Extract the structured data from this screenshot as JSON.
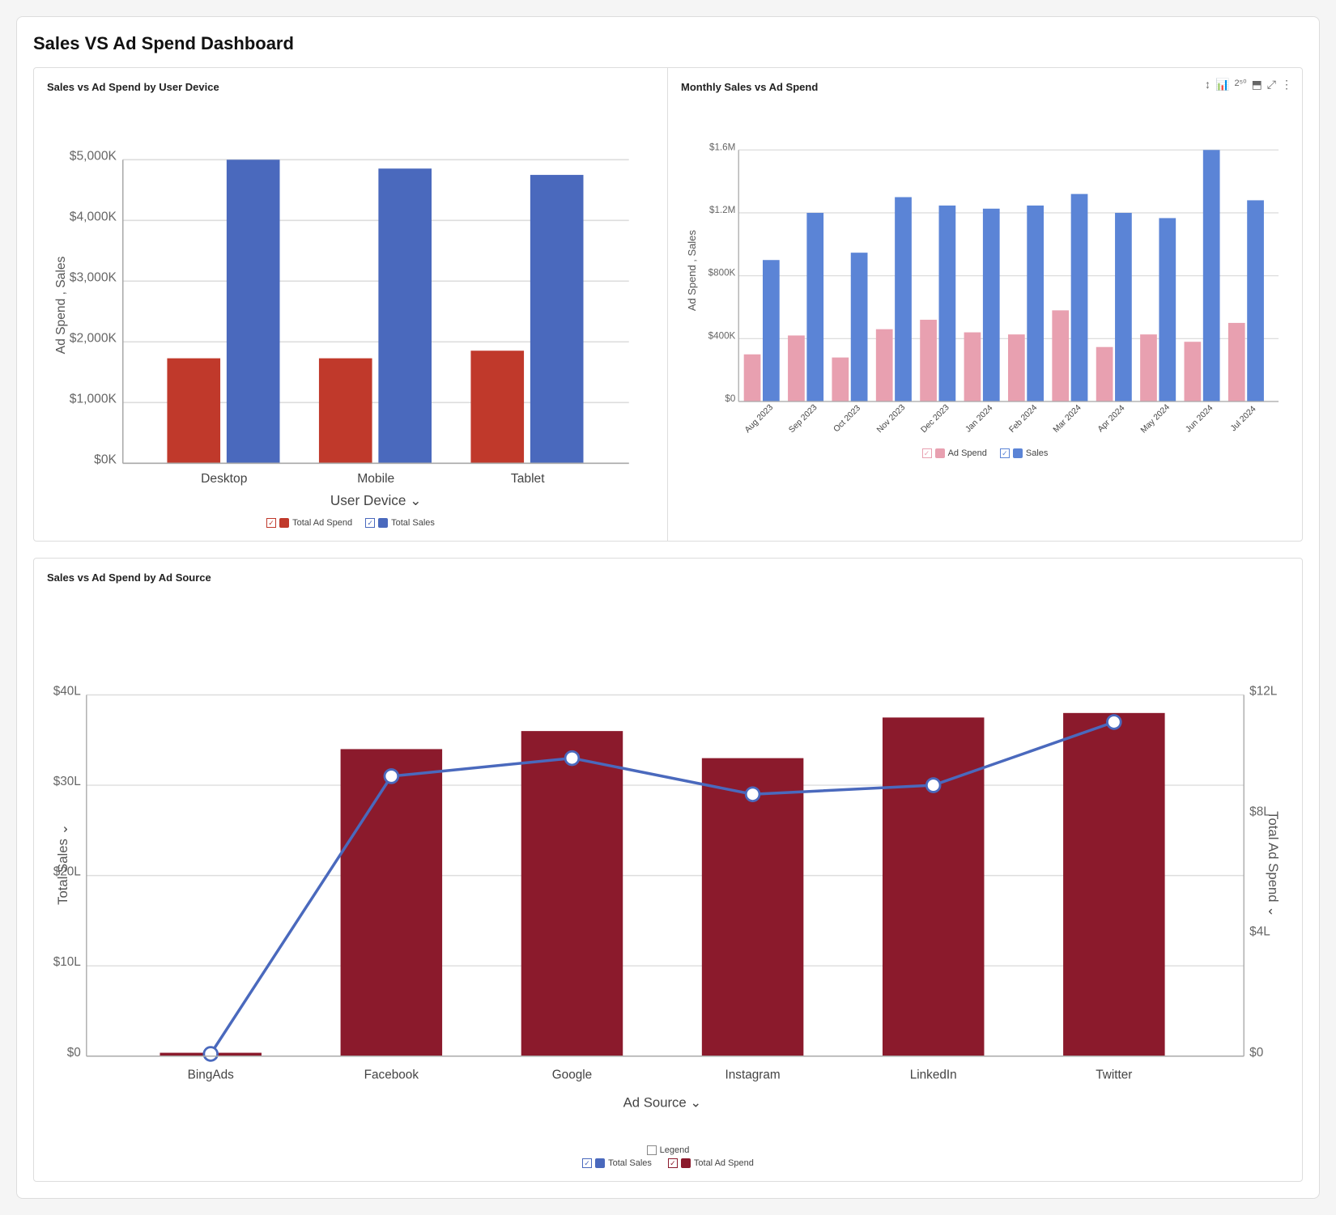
{
  "dashboard": {
    "title": "Sales VS Ad Spend Dashboard",
    "chart1": {
      "title": "Sales vs Ad Spend by User Device",
      "yAxisLabel": "Ad Spend , Sales",
      "xAxisLabel": "User Device",
      "xAxisLabelSuffix": "⌄",
      "categories": [
        "Desktop",
        "Mobile",
        "Tablet"
      ],
      "series": {
        "adSpend": {
          "label": "Total Ad Spend",
          "color": "#c0392b",
          "values": [
            1800,
            1800,
            1950
          ]
        },
        "sales": {
          "label": "Total Sales",
          "color": "#4a69bd",
          "values": [
            5000,
            4850,
            4750
          ]
        }
      },
      "yTicks": [
        "$0K",
        "$1,000K",
        "$2,000K",
        "$3,000K",
        "$4,000K",
        "$5,000K"
      ],
      "legend": [
        {
          "label": "Total Ad Spend",
          "color": "#c0392b"
        },
        {
          "label": "Total Sales",
          "color": "#4a69bd"
        }
      ]
    },
    "chart2": {
      "title": "Monthly Sales vs Ad Spend",
      "yAxisLabel": "Ad Spend , Sales",
      "categories": [
        "Aug 2023",
        "Sep 2023",
        "Oct 2023",
        "Nov 2023",
        "Dec 2023",
        "Jan 2024",
        "Feb 2024",
        "Mar 2024",
        "Apr 2024",
        "May 2024",
        "Jun 2024",
        "Jul 2024"
      ],
      "series": {
        "adSpend": {
          "label": "Ad Spend",
          "color": "#e8b4bc",
          "values": [
            300,
            420,
            280,
            460,
            520,
            440,
            430,
            580,
            350,
            430,
            380,
            500
          ]
        },
        "sales": {
          "label": "Sales",
          "color": "#5b84d6",
          "values": [
            900,
            1200,
            950,
            1300,
            1250,
            1230,
            1250,
            1320,
            1200,
            1170,
            1600,
            1280
          ]
        }
      },
      "yTicks": [
        "$0",
        "$400K",
        "$800K",
        "$1.2M",
        "$1.6M"
      ],
      "legend": [
        {
          "label": "Ad Spend",
          "color": "#e8a0b0"
        },
        {
          "label": "Sales",
          "color": "#5b84d6"
        }
      ],
      "toolbar": [
        "sort-icon",
        "bar-chart-icon",
        "25x-icon",
        "export-icon",
        "expand-icon",
        "more-icon"
      ]
    },
    "chart3": {
      "title": "Sales vs Ad Spend by Ad Source",
      "yLeftLabel": "Total Sales",
      "yRightLabel": "Total Ad Spend",
      "xAxisLabel": "Ad Source",
      "categories": [
        "BingAds",
        "Facebook",
        "Google",
        "Instagram",
        "LinkedIn",
        "Twitter"
      ],
      "barSeries": {
        "label": "Total Ad Spend",
        "color": "#8b1a2c",
        "values": [
          5,
          340,
          360,
          330,
          375,
          380
        ]
      },
      "lineSeries": {
        "label": "Total Sales",
        "color": "#4a69bd",
        "values": [
          2,
          310,
          330,
          290,
          300,
          370
        ]
      },
      "yLeftTicks": [
        "$0",
        "$10L",
        "$20L",
        "$30L",
        "$40L"
      ],
      "yRightTicks": [
        "$0",
        "$4L",
        "$8L",
        "$12L"
      ],
      "legend": {
        "main": "Legend",
        "items": [
          {
            "label": "Total Sales",
            "color": "#4a69bd",
            "type": "checkbox"
          },
          {
            "label": "Total Ad Spend",
            "color": "#8b1a2c",
            "type": "checkbox"
          }
        ]
      }
    }
  }
}
